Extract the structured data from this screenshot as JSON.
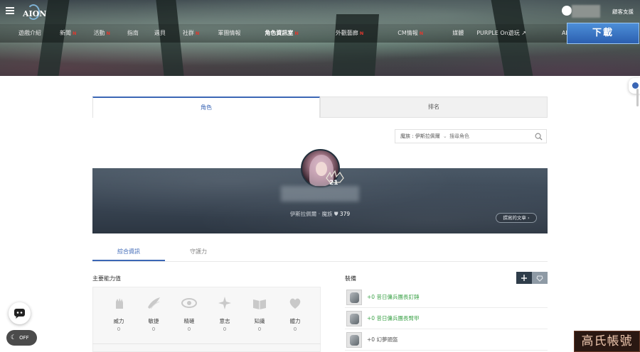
{
  "header": {
    "logo_text": "AION",
    "support_label": "顧客支援"
  },
  "nav": {
    "items": [
      {
        "label": "遊戲介紹",
        "new": false,
        "active": false
      },
      {
        "label": "新聞",
        "new": true,
        "active": false
      },
      {
        "label": "活動",
        "new": true,
        "active": false
      },
      {
        "label": "指南",
        "new": false,
        "active": false
      },
      {
        "label": "週貝",
        "new": false,
        "active": false
      },
      {
        "label": "社群",
        "new": true,
        "active": false
      },
      {
        "label": "軍團情報",
        "new": false,
        "active": false
      },
      {
        "label": "角色資訊室",
        "new": true,
        "active": true
      },
      {
        "label": "外觀藝廊",
        "new": true,
        "active": false
      },
      {
        "label": "CM情報",
        "new": true,
        "active": false
      },
      {
        "label": "媒體",
        "new": false,
        "active": false
      },
      {
        "label": "PURPLE On遊玩 ↗",
        "new": false,
        "active": false
      },
      {
        "label": "AION2 SHOP ↗",
        "new": false,
        "active": false
      }
    ],
    "new_badge": "N",
    "download_label": "下載"
  },
  "tabs": {
    "character": "角色",
    "ranking": "排名"
  },
  "search": {
    "server_label": "魔族 : 伊斯拉佩爾",
    "server_chevron": "⌄",
    "placeholder": "搜尋角色"
  },
  "profile": {
    "level": "21",
    "server": "伊斯拉佩爾",
    "separator": "·",
    "race": "魔族",
    "power": "379",
    "posts_button": "撰寫的文章 ›"
  },
  "subtabs": {
    "overview": "綜合資訊",
    "guardian": "守護力"
  },
  "stats": {
    "title": "主要能力值",
    "items": [
      {
        "label": "威力",
        "value": "0",
        "icon": "fist-icon"
      },
      {
        "label": "敏捷",
        "value": "0",
        "icon": "wing-icon"
      },
      {
        "label": "精確",
        "value": "0",
        "icon": "eye-icon"
      },
      {
        "label": "意志",
        "value": "0",
        "icon": "star-burst-icon"
      },
      {
        "label": "知識",
        "value": "0",
        "icon": "book-icon"
      },
      {
        "label": "體力",
        "value": "0",
        "icon": "heart-icon"
      }
    ]
  },
  "equipment": {
    "title": "裝備",
    "items": [
      {
        "label": "+0 昔日傭兵團長釘錘",
        "color": "green"
      },
      {
        "label": "+0 昔日傭兵團長臂甲",
        "color": "green"
      },
      {
        "label": "+0 幻夢頭盔",
        "color": "gray"
      }
    ]
  },
  "darkmode": {
    "label": "OFF"
  },
  "watermark": {
    "text": "高氏帳號"
  },
  "colors": {
    "accent": "#3b66b5",
    "new_badge": "#e0392f",
    "equip_green": "#3ea34a"
  }
}
